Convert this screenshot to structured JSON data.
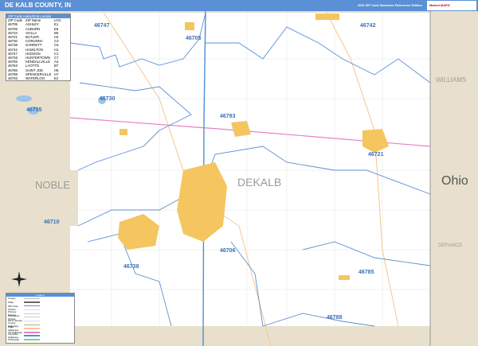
{
  "header": {
    "title": "DE KALB COUNTY, IN",
    "subtitle": "2020 ZIP Code Business Reference Edition",
    "logo": "Market MAPS"
  },
  "zip_index": {
    "heading": "ZIP Code Index/Grid Locator",
    "columns": [
      "ZIP Code",
      "ZIP Name",
      "LOC"
    ],
    "rows": [
      [
        "46705",
        "ASHLEY",
        "E1"
      ],
      [
        "46706",
        "AUBURN",
        "E5"
      ],
      [
        "46710",
        "AVILLA",
        "B5"
      ],
      [
        "46721",
        "BUTLER",
        "H4"
      ],
      [
        "46730",
        "CORUNNA",
        "C3"
      ],
      [
        "46738",
        "GARRETT",
        "C6"
      ],
      [
        "46742",
        "HAMILTON",
        "H1"
      ],
      [
        "46747",
        "HUDSON",
        "C1"
      ],
      [
        "46748",
        "HUNTERTOWN",
        "C7"
      ],
      [
        "46755",
        "KENDALLVILLE",
        "A3"
      ],
      [
        "46763",
        "LAOTTO",
        "B7"
      ],
      [
        "46785",
        "SAINT JOE",
        "H6"
      ],
      [
        "46788",
        "SPENCERVILLE",
        "H7"
      ],
      [
        "46793",
        "WATERLOO",
        "E2"
      ]
    ]
  },
  "map": {
    "zip_labels": [
      "46747",
      "46705",
      "46742",
      "46730",
      "46755",
      "46793",
      "46721",
      "46710",
      "46738",
      "46706",
      "46785",
      "46788"
    ],
    "region_labels": {
      "county": "DEKALB",
      "west": "NOBLE",
      "east_state": "Ohio",
      "northeast": "WILLIAMS",
      "southeast": "DEFIANCE"
    },
    "colors": {
      "zip_boundary": "#5b8fd6",
      "city": "#f5c560",
      "outside": "#e8e0cc",
      "highway": "#f5c890",
      "us_highway": "#e880c8",
      "interstate": "#4a90d9",
      "title_bar": "#5b8fd6"
    }
  },
  "legend": {
    "heading": "Legend",
    "rows": [
      "County",
      "State",
      "ZIP Code",
      "Streets",
      "Primary Streets",
      "Secondary Streets",
      "Minor Streets",
      "County Highways",
      "State Highways",
      "US Highways",
      "Interstate Highways",
      "Toll Roads"
    ]
  }
}
